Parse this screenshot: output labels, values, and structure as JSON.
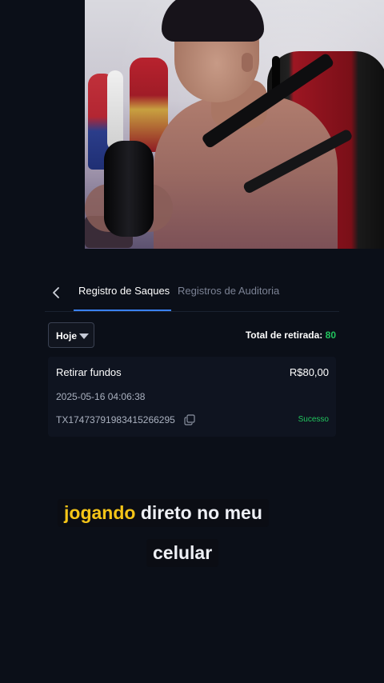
{
  "header": {
    "back_icon": "chevron-left-icon",
    "tabs": [
      {
        "label": "Registro de Saques",
        "active": true
      },
      {
        "label": "Registros de Auditoria",
        "active": false
      }
    ]
  },
  "filter": {
    "selected": "Hoje",
    "icon": "caret-down-icon"
  },
  "summary": {
    "total_label": "Total de retirada:",
    "total_value": "80"
  },
  "transactions": [
    {
      "title": "Retirar fundos",
      "amount": "R$80,00",
      "datetime": "2025-05-16 04:06:38",
      "tx_id": "TX17473791983415266295",
      "status": "Sucesso"
    }
  ],
  "captions": {
    "line1_highlight": "jogando",
    "line1_rest": " direto no meu",
    "line2": "celular"
  },
  "colors": {
    "background": "#0b0f18",
    "accent_tab": "#3b82f6",
    "success": "#22c55e",
    "caption_highlight": "#f5c518"
  }
}
